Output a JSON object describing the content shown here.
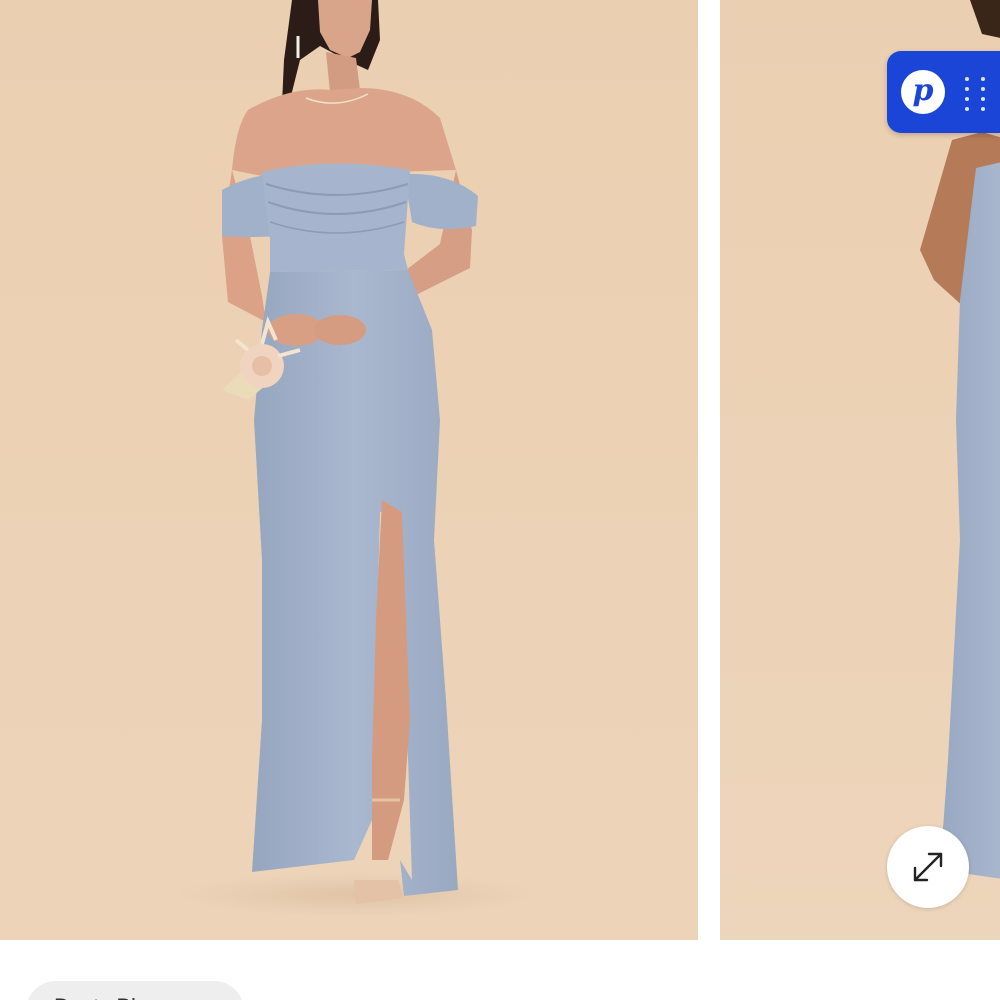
{
  "gallery": {
    "images": [
      {
        "alt": ""
      },
      {
        "alt": ""
      }
    ],
    "background_color": "#ecd3b6",
    "dress_color": "#a7b5cd"
  },
  "badge": {
    "logo_text": "p",
    "color": "#1a45d6",
    "icon": "grip-dots-icon"
  },
  "expand": {
    "icon": "expand-arrows-icon"
  },
  "chip": {
    "label": "Dusty Blue"
  }
}
